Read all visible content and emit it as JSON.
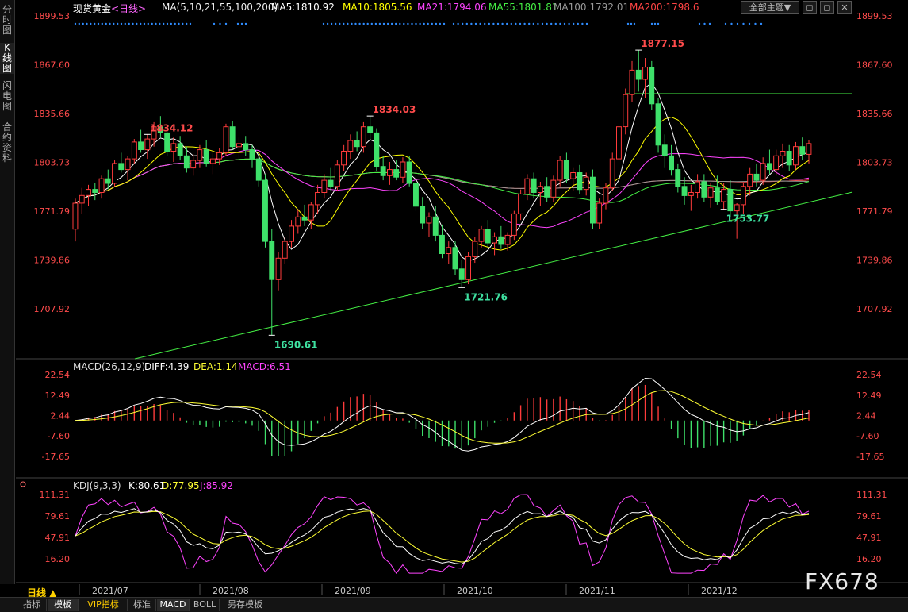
{
  "sidebar": {
    "tabs": [
      {
        "label": "分时图"
      },
      {
        "label": "K线图"
      },
      {
        "label": "闪电图"
      },
      {
        "label": "合约资料"
      }
    ]
  },
  "header": {
    "symbol": "现货黄金",
    "period_tag": "<日线>",
    "ma_params": "MA(5,10,21,55,100,200)",
    "ma": [
      {
        "label": "MA5:1810.92",
        "color": "#ffffff"
      },
      {
        "label": "MA10:1805.56",
        "color": "#ffff00"
      },
      {
        "label": "MA21:1794.06",
        "color": "#ff44ff"
      },
      {
        "label": "MA55:1801.81",
        "color": "#44ee44"
      },
      {
        "label": "MA100:1792.01",
        "color": "#999999"
      },
      {
        "label": "MA200:1798.6",
        "color": "#ff4444"
      }
    ],
    "main_theme_button": "全部主题▼",
    "window_buttons": [
      "◻",
      "◻",
      "✕"
    ]
  },
  "price_panel": {
    "axis_labels": [
      "1899.53",
      "1867.60",
      "1835.66",
      "1803.73",
      "1771.79",
      "1739.86",
      "1707.92"
    ],
    "annotations": {
      "high_jul": "1834.12",
      "high_sep": "1834.03",
      "high_nov": "1877.15",
      "low_aug": "1690.61",
      "low_sep": "1721.76",
      "low_dec": "1753.77"
    }
  },
  "macd_panel": {
    "title": "MACD(26,12,9)",
    "diff": "DIFF:4.39",
    "dea": "DEA:1.14",
    "macd": "MACD:6.51",
    "axis_labels": [
      "22.54",
      "12.49",
      "2.44",
      "-7.60",
      "-17.65"
    ]
  },
  "kdj_panel": {
    "title": "KDJ(9,3,3)",
    "k": "K:80.61",
    "d": "D:77.95",
    "j": "J:85.92",
    "axis_labels": [
      "111.31",
      "79.61",
      "47.91",
      "16.20"
    ]
  },
  "x_axis": {
    "labels": [
      "2021/07",
      "2021/08",
      "2021/09",
      "2021/10",
      "2021/11",
      "2021/12"
    ]
  },
  "period_button": "日线 ▲",
  "bottom_tabs": [
    {
      "label": "指标",
      "active": false
    },
    {
      "label": "模板",
      "active": true
    },
    {
      "label": "VIP指标",
      "active": false
    },
    {
      "label": "标准",
      "active": false
    },
    {
      "label": "MACD",
      "active": true
    },
    {
      "label": "BOLL",
      "active": false
    },
    {
      "label": "另存模板",
      "active": false
    }
  ],
  "watermark": "FX678",
  "colors": {
    "up": "#ff3b3b",
    "down": "#3ee06a",
    "axis_text": "#ff4b4b",
    "macd_text": "#ff4b4b",
    "trendline": "#44ee44"
  },
  "chart_data": {
    "type": "candlestick",
    "instrument": "现货黄金",
    "period": "日线",
    "ylim": [
      1690.0,
      1900.0
    ],
    "candles": [
      [
        1760,
        1780,
        1752,
        1777
      ],
      [
        1777,
        1787,
        1770,
        1782
      ],
      [
        1782,
        1789,
        1775,
        1786
      ],
      [
        1786,
        1790,
        1779,
        1784
      ],
      [
        1784,
        1795,
        1780,
        1793
      ],
      [
        1793,
        1799,
        1786,
        1790
      ],
      [
        1790,
        1805,
        1788,
        1803
      ],
      [
        1803,
        1810,
        1797,
        1799
      ],
      [
        1799,
        1808,
        1792,
        1806
      ],
      [
        1806,
        1819,
        1803,
        1817
      ],
      [
        1817,
        1825,
        1810,
        1812
      ],
      [
        1812,
        1822,
        1806,
        1819
      ],
      [
        1819,
        1830,
        1814,
        1827
      ],
      [
        1827,
        1834,
        1820,
        1823
      ],
      [
        1823,
        1827,
        1808,
        1811
      ],
      [
        1811,
        1820,
        1804,
        1816
      ],
      [
        1816,
        1821,
        1805,
        1808
      ],
      [
        1808,
        1814,
        1797,
        1800
      ],
      [
        1800,
        1809,
        1795,
        1805
      ],
      [
        1805,
        1815,
        1800,
        1812
      ],
      [
        1812,
        1818,
        1801,
        1803
      ],
      [
        1803,
        1810,
        1796,
        1806
      ],
      [
        1806,
        1813,
        1802,
        1810
      ],
      [
        1810,
        1829,
        1808,
        1827
      ],
      [
        1827,
        1831,
        1812,
        1814
      ],
      [
        1814,
        1820,
        1806,
        1816
      ],
      [
        1816,
        1821,
        1808,
        1812
      ],
      [
        1812,
        1815,
        1800,
        1806
      ],
      [
        1806,
        1810,
        1788,
        1792
      ],
      [
        1792,
        1796,
        1748,
        1752
      ],
      [
        1752,
        1760,
        1690.61,
        1727
      ],
      [
        1727,
        1745,
        1720,
        1741
      ],
      [
        1741,
        1755,
        1737,
        1752
      ],
      [
        1752,
        1766,
        1748,
        1762
      ],
      [
        1762,
        1773,
        1757,
        1768
      ],
      [
        1768,
        1776,
        1762,
        1766
      ],
      [
        1766,
        1778,
        1760,
        1776
      ],
      [
        1776,
        1789,
        1770,
        1784
      ],
      [
        1784,
        1796,
        1780,
        1792
      ],
      [
        1792,
        1800,
        1785,
        1788
      ],
      [
        1788,
        1805,
        1785,
        1802
      ],
      [
        1802,
        1815,
        1798,
        1811
      ],
      [
        1811,
        1822,
        1806,
        1818
      ],
      [
        1818,
        1824,
        1811,
        1814
      ],
      [
        1814,
        1830,
        1810,
        1827
      ],
      [
        1827,
        1834.03,
        1818,
        1823
      ],
      [
        1823,
        1826,
        1798,
        1801
      ],
      [
        1801,
        1808,
        1792,
        1795
      ],
      [
        1795,
        1804,
        1789,
        1799
      ],
      [
        1799,
        1805,
        1792,
        1794
      ],
      [
        1794,
        1807,
        1790,
        1804
      ],
      [
        1804,
        1808,
        1788,
        1790
      ],
      [
        1790,
        1795,
        1772,
        1775
      ],
      [
        1775,
        1781,
        1760,
        1764
      ],
      [
        1764,
        1771,
        1755,
        1768
      ],
      [
        1768,
        1775,
        1752,
        1756
      ],
      [
        1756,
        1763,
        1741,
        1744
      ],
      [
        1744,
        1752,
        1737,
        1748
      ],
      [
        1748,
        1752,
        1730,
        1734
      ],
      [
        1734,
        1740,
        1721.76,
        1727
      ],
      [
        1727,
        1745,
        1724,
        1742
      ],
      [
        1742,
        1755,
        1738,
        1752
      ],
      [
        1752,
        1762,
        1748,
        1760
      ],
      [
        1760,
        1766,
        1748,
        1751
      ],
      [
        1751,
        1758,
        1743,
        1755
      ],
      [
        1755,
        1762,
        1747,
        1750
      ],
      [
        1750,
        1758,
        1746,
        1756
      ],
      [
        1756,
        1772,
        1753,
        1770
      ],
      [
        1770,
        1786,
        1766,
        1783
      ],
      [
        1783,
        1796,
        1779,
        1793
      ],
      [
        1793,
        1797,
        1780,
        1784
      ],
      [
        1784,
        1791,
        1775,
        1788
      ],
      [
        1788,
        1794,
        1778,
        1781
      ],
      [
        1781,
        1795,
        1778,
        1792
      ],
      [
        1792,
        1808,
        1788,
        1805
      ],
      [
        1805,
        1810,
        1790,
        1793
      ],
      [
        1793,
        1800,
        1785,
        1797
      ],
      [
        1797,
        1802,
        1783,
        1786
      ],
      [
        1786,
        1797,
        1782,
        1794
      ],
      [
        1794,
        1799,
        1760,
        1764
      ],
      [
        1764,
        1780,
        1760,
        1777
      ],
      [
        1777,
        1790,
        1773,
        1787
      ],
      [
        1787,
        1810,
        1785,
        1806
      ],
      [
        1806,
        1830,
        1802,
        1827
      ],
      [
        1827,
        1852,
        1822,
        1848
      ],
      [
        1848,
        1870,
        1843,
        1864
      ],
      [
        1864,
        1877.15,
        1850,
        1858
      ],
      [
        1858,
        1872,
        1846,
        1866
      ],
      [
        1866,
        1870,
        1838,
        1842
      ],
      [
        1842,
        1846,
        1810,
        1815
      ],
      [
        1815,
        1822,
        1800,
        1808
      ],
      [
        1808,
        1815,
        1795,
        1799
      ],
      [
        1799,
        1803,
        1784,
        1788
      ],
      [
        1788,
        1794,
        1776,
        1782
      ],
      [
        1782,
        1789,
        1772,
        1784
      ],
      [
        1784,
        1796,
        1780,
        1791
      ],
      [
        1791,
        1796,
        1778,
        1781
      ],
      [
        1781,
        1790,
        1774,
        1787
      ],
      [
        1787,
        1795,
        1776,
        1778
      ],
      [
        1778,
        1790,
        1773,
        1786
      ],
      [
        1786,
        1792,
        1768,
        1772
      ],
      [
        1772,
        1777,
        1753.77,
        1776
      ],
      [
        1776,
        1790,
        1770,
        1788
      ],
      [
        1788,
        1800,
        1782,
        1796
      ],
      [
        1796,
        1803,
        1788,
        1792
      ],
      [
        1792,
        1807,
        1789,
        1803
      ],
      [
        1803,
        1812,
        1796,
        1799
      ],
      [
        1799,
        1812,
        1795,
        1808
      ],
      [
        1808,
        1816,
        1800,
        1811
      ],
      [
        1811,
        1815,
        1798,
        1802
      ],
      [
        1802,
        1817,
        1799,
        1814
      ],
      [
        1814,
        1820,
        1805,
        1809
      ],
      [
        1809,
        1818,
        1803,
        1816
      ]
    ]
  }
}
